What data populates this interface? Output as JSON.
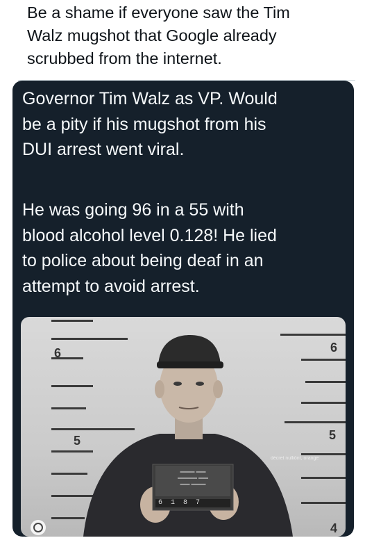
{
  "tweet": {
    "text": "Be a shame if everyone saw the Tim\nWalz mugshot that Google already\nscrubbed from the internet."
  },
  "quoted_image": {
    "paragraph1": "Governor Tim Walz as VP. Would\nbe a pity if his mugshot from his\nDUI arrest went viral.",
    "paragraph2": "He was going 96 in a 55 with\nblood alcohol level 0.128! He lied\nto police about being deaf in an\nattempt to avoid arrest.",
    "height_marks": {
      "left_top": "6",
      "left_mid": "5",
      "right_top": "6",
      "right_mid": "5",
      "right_bottom": "4"
    },
    "placard_numbers": "6 1 8 7",
    "watermark": "décret nulliönt, orange",
    "colors": {
      "card_bg": "#15202b",
      "card_text": "#f5f8fa",
      "photo_bg": "#d9d9d9",
      "shirt": "#2a2a2e",
      "placard": "#3c3c3c"
    }
  }
}
